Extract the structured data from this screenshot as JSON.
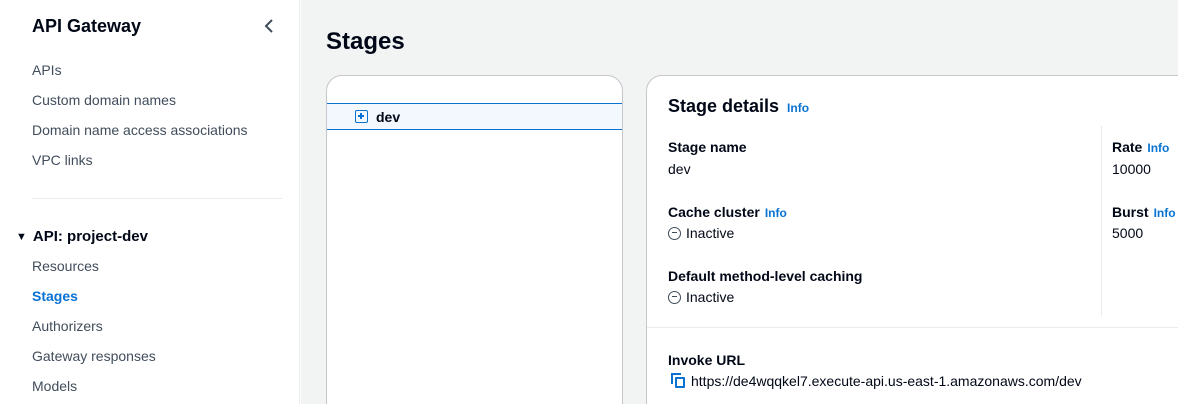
{
  "sidebar": {
    "title": "API Gateway",
    "collapse_icon": "chevron-left-icon",
    "links": [
      "APIs",
      "Custom domain names",
      "Domain name access associations",
      "VPC links"
    ],
    "api_section": {
      "label": "API: project-dev",
      "expanded": true,
      "items": [
        "Resources",
        "Stages",
        "Authorizers",
        "Gateway responses",
        "Models"
      ],
      "active_item": "Stages"
    }
  },
  "page": {
    "title": "Stages"
  },
  "stage_tree": {
    "items": [
      {
        "label": "dev",
        "icon": "expand-plus-icon",
        "selected": true
      }
    ]
  },
  "stage_details": {
    "title": "Stage details",
    "info_label": "Info",
    "stage_name": {
      "label": "Stage name",
      "value": "dev"
    },
    "cache_cluster": {
      "label": "Cache cluster",
      "info": "Info",
      "value": "Inactive",
      "icon": "status-stopped-icon"
    },
    "default_caching": {
      "label": "Default method-level caching",
      "value": "Inactive",
      "icon": "status-stopped-icon"
    },
    "rate": {
      "label": "Rate",
      "info": "Info",
      "value": "10000"
    },
    "burst": {
      "label": "Burst",
      "info": "Info",
      "value": "5000"
    },
    "invoke_url": {
      "label": "Invoke URL",
      "icon": "copy-icon",
      "value": "https://de4wqqkel7.execute-api.us-east-1.amazonaws.com/dev"
    }
  },
  "colors": {
    "link_blue": "#0972d3",
    "text": "#000716",
    "muted_text": "#414d5c",
    "selected_bg": "#f2f8fd",
    "main_bg": "#f2f3f3",
    "border": "#c6c6cd"
  }
}
